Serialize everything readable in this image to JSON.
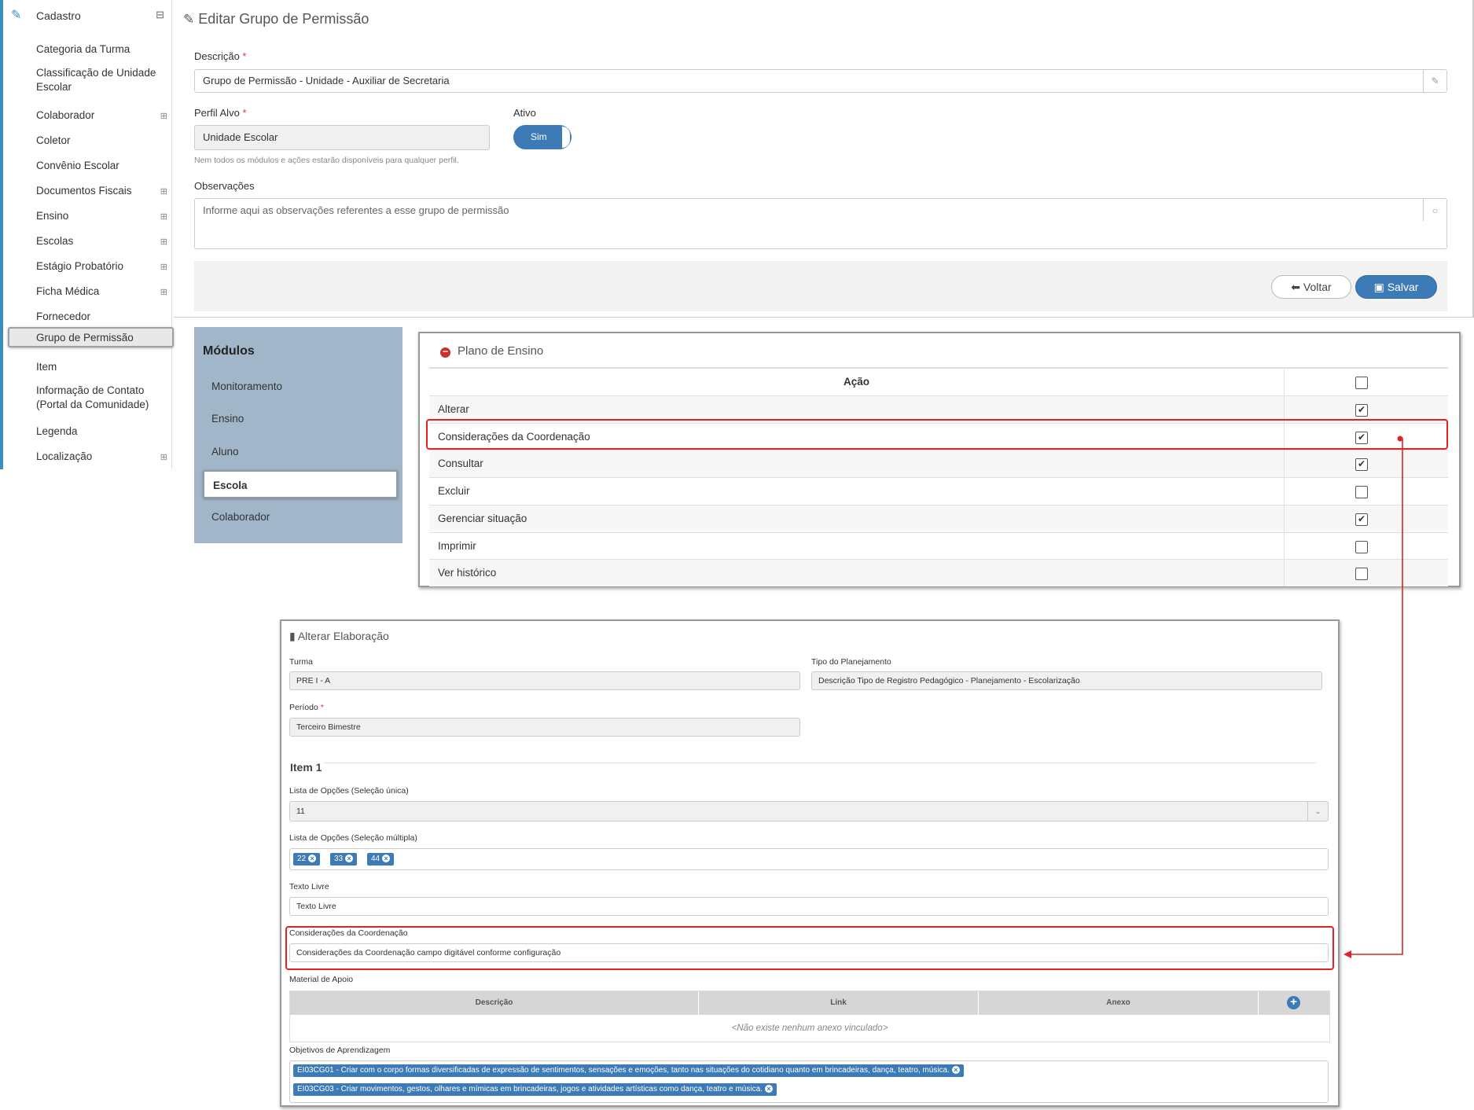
{
  "sidebar": {
    "header": "Cadastro",
    "items": [
      {
        "label": "Categoria da Turma",
        "expandable": false
      },
      {
        "label": "Classificação de Unidade Escolar",
        "expandable": false
      },
      {
        "label": "Colaborador",
        "expandable": true
      },
      {
        "label": "Coletor",
        "expandable": false
      },
      {
        "label": "Convênio Escolar",
        "expandable": false
      },
      {
        "label": "Documentos Fiscais",
        "expandable": true
      },
      {
        "label": "Ensino",
        "expandable": true
      },
      {
        "label": "Escolas",
        "expandable": true
      },
      {
        "label": "Estágio Probatório",
        "expandable": true
      },
      {
        "label": "Ficha Médica",
        "expandable": true
      },
      {
        "label": "Fornecedor",
        "expandable": false
      },
      {
        "label": "Grupo de Permissão",
        "expandable": false,
        "active": true
      },
      {
        "label": "Item",
        "expandable": false
      },
      {
        "label": "Informação de Contato (Portal da Comunidade)",
        "expandable": false
      },
      {
        "label": "Legenda",
        "expandable": false
      },
      {
        "label": "Localização",
        "expandable": true
      }
    ]
  },
  "form": {
    "title": "Editar Grupo de Permissão",
    "descricao_label": "Descrição",
    "descricao_value": "Grupo de Permissão - Unidade - Auxiliar de Secretaria",
    "perfil_label": "Perfil Alvo",
    "perfil_value": "Unidade Escolar",
    "perfil_hint": "Nem todos os módulos e ações estarão disponíveis para qualquer perfil.",
    "ativo_label": "Ativo",
    "ativo_value": "Sim",
    "obs_label": "Observações",
    "obs_placeholder": "Informe aqui as observações referentes a esse grupo de permissão",
    "voltar": "Voltar",
    "salvar": "Salvar",
    "required_mark": "*"
  },
  "modules": {
    "title": "Módulos",
    "items": [
      "Monitoramento",
      "Ensino",
      "Aluno",
      "Escola",
      "Colaborador"
    ],
    "active": "Escola"
  },
  "plano": {
    "title": "Plano de Ensino",
    "col_acao": "Ação",
    "rows": [
      {
        "label": "Alterar",
        "checked": true
      },
      {
        "label": "Considerações da Coordenação",
        "checked": true,
        "highlight": true
      },
      {
        "label": "Consultar",
        "checked": true
      },
      {
        "label": "Excluir",
        "checked": false
      },
      {
        "label": "Gerenciar situação",
        "checked": true
      },
      {
        "label": "Imprimir",
        "checked": false
      },
      {
        "label": "Ver histórico",
        "checked": false
      }
    ]
  },
  "elab": {
    "title": "Alterar Elaboração",
    "turma_label": "Turma",
    "turma_value": "PRE I - A",
    "tipo_label": "Tipo do Planejamento",
    "tipo_value": "Descrição Tipo de Registro Pedagógico - Planejamento - Escolarização",
    "periodo_label": "Período",
    "periodo_value": "Terceiro Bimestre",
    "item_title": "Item 1",
    "lista_unica_label": "Lista de Opções (Seleção única)",
    "lista_unica_value": "11",
    "lista_multipla_label": "Lista de Opções (Seleção múltipla)",
    "lista_multipla_tags": [
      "22",
      "33",
      "44"
    ],
    "texto_livre_label": "Texto Livre",
    "texto_livre_value": "Texto Livre",
    "consid_label": "Considerações da Coordenação",
    "consid_value": "Considerações da Coordenação campo digitável conforme configuração",
    "material_label": "Material de Apoio",
    "material_cols": [
      "Descrição",
      "Link",
      "Anexo"
    ],
    "material_empty": "<Não existe nenhum anexo vinculado>",
    "objetivos_label": "Objetivos de Aprendizagem",
    "objetivos": [
      "EI03CG01 - Criar com o corpo formas diversificadas de expressão de sentimentos, sensações e emoções, tanto nas situações do cotidiano quanto em brincadeiras, dança, teatro, música.",
      "EI03CG03 - Criar movimentos, gestos, olhares e mímicas em brincadeiras, jogos e atividades artísticas como dança, teatro e música."
    ]
  },
  "colors": {
    "accent": "#3c7bb5",
    "highlight": "#e02424",
    "modules_bg": "#a2b6c9"
  }
}
